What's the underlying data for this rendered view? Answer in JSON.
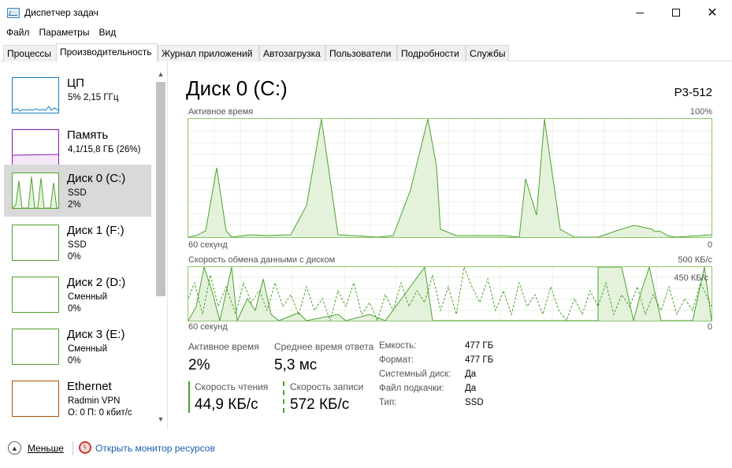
{
  "window": {
    "title": "Диспетчер задач"
  },
  "menu": [
    "Файл",
    "Параметры",
    "Вид"
  ],
  "tabs": [
    "Процессы",
    "Производительность",
    "Журнал приложений",
    "Автозагрузка",
    "Пользователи",
    "Подробности",
    "Службы"
  ],
  "sidebar": {
    "items": [
      {
        "name": "ЦП",
        "sub1": "5% 2,15 ГГц",
        "sub2": "",
        "color": "#117dbb"
      },
      {
        "name": "Память",
        "sub1": "4,1/15,8 ГБ (26%)",
        "sub2": "",
        "color": "#8b12ae"
      },
      {
        "name": "Диск 0 (C:)",
        "sub1": "SSD",
        "sub2": "2%",
        "color": "#4da22e"
      },
      {
        "name": "Диск 1 (F:)",
        "sub1": "SSD",
        "sub2": "0%",
        "color": "#4da22e"
      },
      {
        "name": "Диск 2 (D:)",
        "sub1": "Сменный",
        "sub2": "0%",
        "color": "#4da22e"
      },
      {
        "name": "Диск 3 (E:)",
        "sub1": "Сменный",
        "sub2": "0%",
        "color": "#4da22e"
      },
      {
        "name": "Ethernet",
        "sub1": "Radmin VPN",
        "sub2": "О: 0 П: 0 кбит/с",
        "color": "#a74f01"
      }
    ]
  },
  "main": {
    "title": "Диск 0 (C:)",
    "model": "P3-512",
    "graph1": {
      "label": "Активное время",
      "max": "100%",
      "time": "60 секунд",
      "min": "0"
    },
    "graph2": {
      "label": "Скорость обмена данными с диском",
      "max": "500 КБ/с",
      "inner_marker": "450 КБ/с",
      "time": "60 секунд",
      "min": "0"
    },
    "stats": {
      "active_time_label": "Активное время",
      "active_time_value": "2%",
      "avg_response_label": "Среднее время ответа",
      "avg_response_value": "5,3 мс",
      "read_speed_label": "Скорость чтения",
      "read_speed_value": "44,9 КБ/с",
      "write_speed_label": "Скорость записи",
      "write_speed_value": "572 КБ/с"
    },
    "props": [
      {
        "label": "Емкость:",
        "value": "477 ГБ"
      },
      {
        "label": "Формат:",
        "value": "477 ГБ"
      },
      {
        "label": "Системный диск:",
        "value": "Да"
      },
      {
        "label": "Файл подкачки:",
        "value": "Да"
      },
      {
        "label": "Тип:",
        "value": "SSD"
      }
    ]
  },
  "footer": {
    "less": "Меньше",
    "resmon": "Открыть монитор ресурсов"
  }
}
